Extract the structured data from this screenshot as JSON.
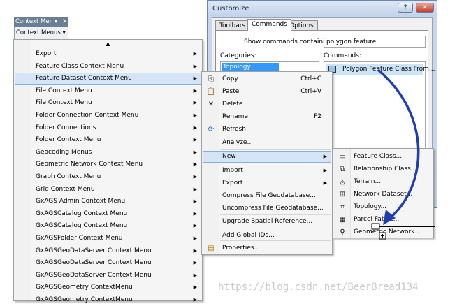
{
  "dialog": {
    "title": "Customize",
    "help_label": "?",
    "close_label": "✕",
    "tabs": [
      "Toolbars",
      "Commands",
      "Options"
    ],
    "active_tab": "Commands",
    "show_label": "Show commands containing:",
    "filter_value": "polygon feature",
    "categories_label": "Categories:",
    "commands_label": "Commands:",
    "selected_category": "Topology",
    "selected_command": "Polygon Feature Class From..."
  },
  "toolbar": {
    "title": "Context Mer",
    "title_arrow": "▾",
    "title_close": "✕",
    "button_label": "Context Menus ▾"
  },
  "menu1": {
    "scroll_glyph": "▲",
    "items": [
      "Export",
      "Feature Class Context Menu",
      "Feature Dataset Context Menu",
      "File Context Menu",
      "File Context Menu",
      "Folder Connection Context Menu",
      "Folder Connections",
      "Folder Context Menu",
      "Geocoding Menus",
      "Geometric Network Context Menu",
      "Graph Context Menu",
      "Grid Context Menu",
      "GxAGS Admin Context Menu",
      "GxAGSCatalog Context Menu",
      "GxAGSCatalog Context Menu",
      "GxAGSFolder Context Menu",
      "GxAGSGeoDataServer Context Menu",
      "GxAGSGeoDataServer Context Menu",
      "GxAGSGeoDataServer Context Menu",
      "GxAGSGeometry ContextMenu",
      "GxAGSGeometry ContextMenu"
    ]
  },
  "menu2": {
    "items": [
      {
        "label": "Copy",
        "shortcut": "Ctrl+C",
        "icon": "copy-icon"
      },
      {
        "label": "Paste",
        "shortcut": "Ctrl+V",
        "icon": "paste-icon"
      },
      {
        "label": "Delete",
        "shortcut": "",
        "icon": "delete-icon"
      },
      {
        "label": "Rename",
        "shortcut": "F2",
        "icon": ""
      },
      {
        "label": "Refresh",
        "shortcut": "",
        "icon": "refresh-icon"
      },
      {
        "label": "Analyze...",
        "shortcut": "",
        "icon": ""
      },
      {
        "label": "New",
        "shortcut": "",
        "icon": ""
      },
      {
        "label": "Import",
        "shortcut": "",
        "icon": ""
      },
      {
        "label": "Export",
        "shortcut": "",
        "icon": ""
      },
      {
        "label": "Compress File Geodatabase...",
        "shortcut": "",
        "icon": ""
      },
      {
        "label": "Uncompress File Geodatabase...",
        "shortcut": "",
        "icon": ""
      },
      {
        "label": "Upgrade Spatial Reference...",
        "shortcut": "",
        "icon": ""
      },
      {
        "label": "Add Global IDs...",
        "shortcut": "",
        "icon": ""
      },
      {
        "label": "Properties...",
        "shortcut": "",
        "icon": "properties-icon"
      }
    ]
  },
  "menu3": {
    "items": [
      {
        "label": "Feature Class...",
        "icon": "feature-class-icon"
      },
      {
        "label": "Relationship Class...",
        "icon": "relationship-class-icon"
      },
      {
        "label": "Terrain...",
        "icon": "terrain-icon"
      },
      {
        "label": "Network Dataset...",
        "icon": "network-dataset-icon"
      },
      {
        "label": "Topology...",
        "icon": "topology-icon"
      },
      {
        "label": "Parcel Fabric...",
        "icon": "parcel-fabric-icon"
      },
      {
        "label": "Geometric Network...",
        "icon": "geometric-network-icon"
      }
    ]
  },
  "watermark": "https://blog.csdn.net/BeerBread134",
  "colors": {
    "drag_arrow": "#1f3fb0",
    "selection": "#3399ff",
    "highlight": "#d5e5f7"
  }
}
